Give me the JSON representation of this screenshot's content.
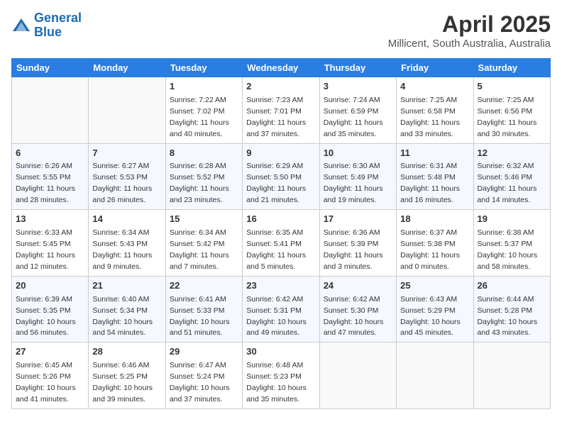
{
  "header": {
    "logo_line1": "General",
    "logo_line2": "Blue",
    "title": "April 2025",
    "subtitle": "Millicent, South Australia, Australia"
  },
  "columns": [
    "Sunday",
    "Monday",
    "Tuesday",
    "Wednesday",
    "Thursday",
    "Friday",
    "Saturday"
  ],
  "weeks": [
    [
      {
        "day": "",
        "info": ""
      },
      {
        "day": "",
        "info": ""
      },
      {
        "day": "1",
        "info": "Sunrise: 7:22 AM\nSunset: 7:02 PM\nDaylight: 11 hours and 40 minutes."
      },
      {
        "day": "2",
        "info": "Sunrise: 7:23 AM\nSunset: 7:01 PM\nDaylight: 11 hours and 37 minutes."
      },
      {
        "day": "3",
        "info": "Sunrise: 7:24 AM\nSunset: 6:59 PM\nDaylight: 11 hours and 35 minutes."
      },
      {
        "day": "4",
        "info": "Sunrise: 7:25 AM\nSunset: 6:58 PM\nDaylight: 11 hours and 33 minutes."
      },
      {
        "day": "5",
        "info": "Sunrise: 7:25 AM\nSunset: 6:56 PM\nDaylight: 11 hours and 30 minutes."
      }
    ],
    [
      {
        "day": "6",
        "info": "Sunrise: 6:26 AM\nSunset: 5:55 PM\nDaylight: 11 hours and 28 minutes."
      },
      {
        "day": "7",
        "info": "Sunrise: 6:27 AM\nSunset: 5:53 PM\nDaylight: 11 hours and 26 minutes."
      },
      {
        "day": "8",
        "info": "Sunrise: 6:28 AM\nSunset: 5:52 PM\nDaylight: 11 hours and 23 minutes."
      },
      {
        "day": "9",
        "info": "Sunrise: 6:29 AM\nSunset: 5:50 PM\nDaylight: 11 hours and 21 minutes."
      },
      {
        "day": "10",
        "info": "Sunrise: 6:30 AM\nSunset: 5:49 PM\nDaylight: 11 hours and 19 minutes."
      },
      {
        "day": "11",
        "info": "Sunrise: 6:31 AM\nSunset: 5:48 PM\nDaylight: 11 hours and 16 minutes."
      },
      {
        "day": "12",
        "info": "Sunrise: 6:32 AM\nSunset: 5:46 PM\nDaylight: 11 hours and 14 minutes."
      }
    ],
    [
      {
        "day": "13",
        "info": "Sunrise: 6:33 AM\nSunset: 5:45 PM\nDaylight: 11 hours and 12 minutes."
      },
      {
        "day": "14",
        "info": "Sunrise: 6:34 AM\nSunset: 5:43 PM\nDaylight: 11 hours and 9 minutes."
      },
      {
        "day": "15",
        "info": "Sunrise: 6:34 AM\nSunset: 5:42 PM\nDaylight: 11 hours and 7 minutes."
      },
      {
        "day": "16",
        "info": "Sunrise: 6:35 AM\nSunset: 5:41 PM\nDaylight: 11 hours and 5 minutes."
      },
      {
        "day": "17",
        "info": "Sunrise: 6:36 AM\nSunset: 5:39 PM\nDaylight: 11 hours and 3 minutes."
      },
      {
        "day": "18",
        "info": "Sunrise: 6:37 AM\nSunset: 5:38 PM\nDaylight: 11 hours and 0 minutes."
      },
      {
        "day": "19",
        "info": "Sunrise: 6:38 AM\nSunset: 5:37 PM\nDaylight: 10 hours and 58 minutes."
      }
    ],
    [
      {
        "day": "20",
        "info": "Sunrise: 6:39 AM\nSunset: 5:35 PM\nDaylight: 10 hours and 56 minutes."
      },
      {
        "day": "21",
        "info": "Sunrise: 6:40 AM\nSunset: 5:34 PM\nDaylight: 10 hours and 54 minutes."
      },
      {
        "day": "22",
        "info": "Sunrise: 6:41 AM\nSunset: 5:33 PM\nDaylight: 10 hours and 51 minutes."
      },
      {
        "day": "23",
        "info": "Sunrise: 6:42 AM\nSunset: 5:31 PM\nDaylight: 10 hours and 49 minutes."
      },
      {
        "day": "24",
        "info": "Sunrise: 6:42 AM\nSunset: 5:30 PM\nDaylight: 10 hours and 47 minutes."
      },
      {
        "day": "25",
        "info": "Sunrise: 6:43 AM\nSunset: 5:29 PM\nDaylight: 10 hours and 45 minutes."
      },
      {
        "day": "26",
        "info": "Sunrise: 6:44 AM\nSunset: 5:28 PM\nDaylight: 10 hours and 43 minutes."
      }
    ],
    [
      {
        "day": "27",
        "info": "Sunrise: 6:45 AM\nSunset: 5:26 PM\nDaylight: 10 hours and 41 minutes."
      },
      {
        "day": "28",
        "info": "Sunrise: 6:46 AM\nSunset: 5:25 PM\nDaylight: 10 hours and 39 minutes."
      },
      {
        "day": "29",
        "info": "Sunrise: 6:47 AM\nSunset: 5:24 PM\nDaylight: 10 hours and 37 minutes."
      },
      {
        "day": "30",
        "info": "Sunrise: 6:48 AM\nSunset: 5:23 PM\nDaylight: 10 hours and 35 minutes."
      },
      {
        "day": "",
        "info": ""
      },
      {
        "day": "",
        "info": ""
      },
      {
        "day": "",
        "info": ""
      }
    ]
  ]
}
